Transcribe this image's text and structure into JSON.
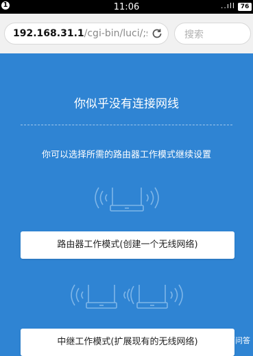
{
  "status_bar": {
    "time": "11:06",
    "battery": "76",
    "notification": "1",
    "signal": "..ıll"
  },
  "browser": {
    "url_host": "192.168.31.1",
    "url_path": "/cgi-bin/luci/;s",
    "search_placeholder": "搜索"
  },
  "page": {
    "title": "你似乎没有连接网线",
    "subtitle": "你可以选择所需的路由器工作模式继续设置",
    "mode_router_button": "路由器工作模式(创建一个无线网络)",
    "mode_repeater_button": "中继工作模式(扩展现有的无线网络)"
  },
  "watermark": {
    "text": "上百问答"
  },
  "colors": {
    "background": "#2f84d3",
    "button": "#ffffff",
    "icon_stroke": "#7fb6e8"
  }
}
